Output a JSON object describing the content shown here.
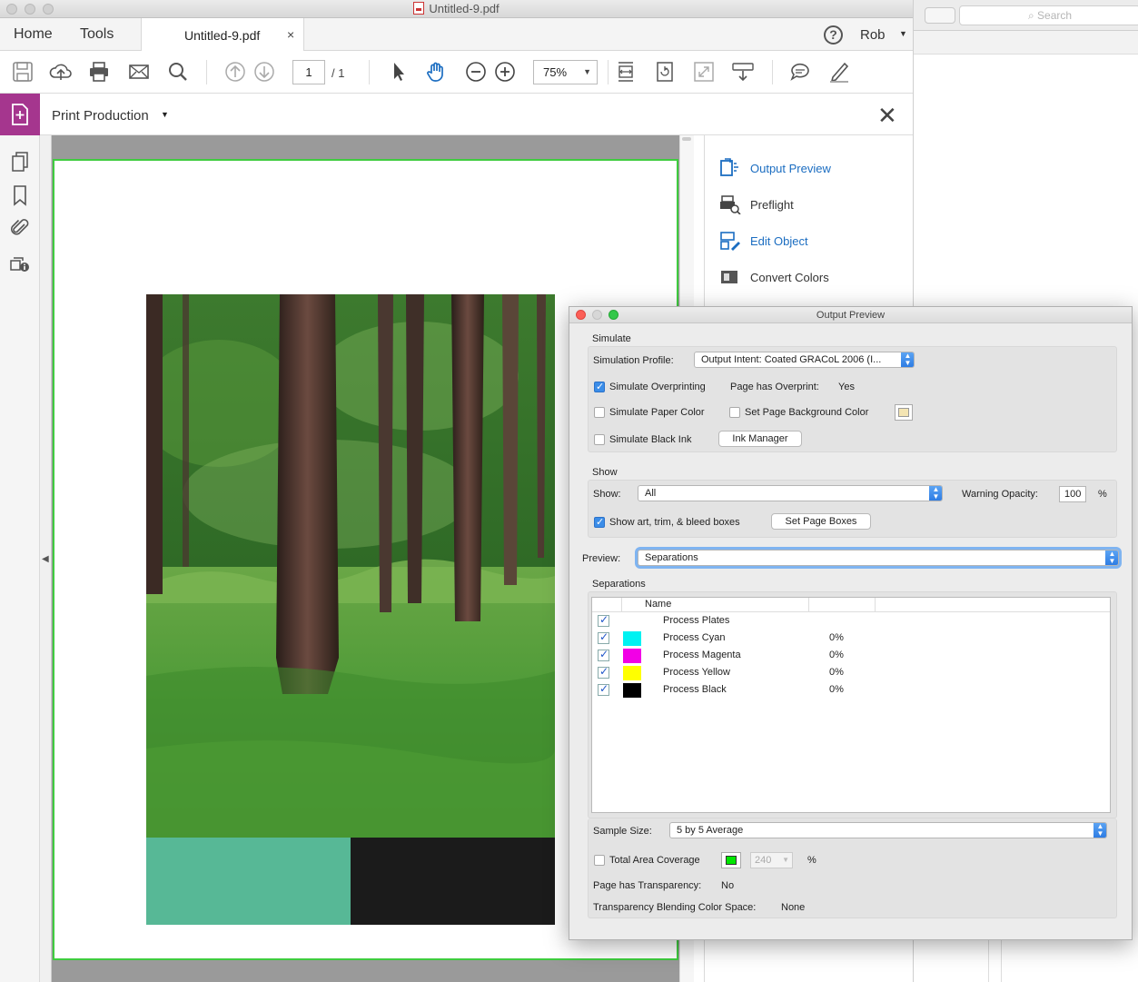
{
  "window": {
    "title": "Untitled-9.pdf"
  },
  "nav": {
    "home": "Home",
    "tools": "Tools",
    "doc_tab": "Untitled-9.pdf",
    "close_tab": "×",
    "help": "?",
    "user": "Rob"
  },
  "toolbar": {
    "page_current": "1",
    "page_total": "/ 1",
    "zoom": "75%"
  },
  "print_production": {
    "title": "Print Production"
  },
  "right_panel": {
    "items": [
      {
        "label": "Output Preview"
      },
      {
        "label": "Preflight"
      },
      {
        "label": "Edit Object"
      },
      {
        "label": "Convert Colors"
      }
    ]
  },
  "background_window": {
    "search_placeholder": "Search"
  },
  "dialog": {
    "title": "Output Preview",
    "simulate": {
      "group_label": "Simulate",
      "profile_label": "Simulation Profile:",
      "profile_value": "Output Intent: Coated GRACoL 2006 (I...",
      "simulate_overprinting": "Simulate Overprinting",
      "overprint_label": "Page has Overprint:",
      "overprint_value": "Yes",
      "simulate_paper_color": "Simulate Paper Color",
      "set_page_bg_color": "Set Page Background Color",
      "simulate_black_ink": "Simulate Black Ink",
      "ink_manager": "Ink Manager"
    },
    "show": {
      "group_label": "Show",
      "show_label": "Show:",
      "show_value": "All",
      "warning_opacity_label": "Warning Opacity:",
      "warning_opacity_value": "100",
      "percent": "%",
      "show_boxes": "Show art, trim, & bleed boxes",
      "set_page_boxes": "Set Page Boxes"
    },
    "preview": {
      "label": "Preview:",
      "value": "Separations"
    },
    "separations": {
      "group_label": "Separations",
      "col_name": "Name",
      "rows": [
        {
          "name": "Process Plates",
          "value": "",
          "color": ""
        },
        {
          "name": "Process Cyan",
          "value": "0%",
          "color": "#00f2f2"
        },
        {
          "name": "Process Magenta",
          "value": "0%",
          "color": "#f200e6"
        },
        {
          "name": "Process Yellow",
          "value": "0%",
          "color": "#ffff00"
        },
        {
          "name": "Process Black",
          "value": "0%",
          "color": "#000000"
        }
      ]
    },
    "sample_size": {
      "label": "Sample Size:",
      "value": "5 by 5 Average"
    },
    "tac": {
      "label": "Total Area Coverage",
      "value": "240",
      "percent": "%"
    },
    "transparency": {
      "label": "Page has Transparency:",
      "value": "No"
    },
    "blend": {
      "label": "Transparency Blending Color Space:",
      "value": "None"
    }
  },
  "colors": {
    "accent_purple": "#a5368e",
    "link_blue": "#1b6dc1",
    "page_border": "#3fcc3f",
    "teal_swatch": "#57b896"
  }
}
